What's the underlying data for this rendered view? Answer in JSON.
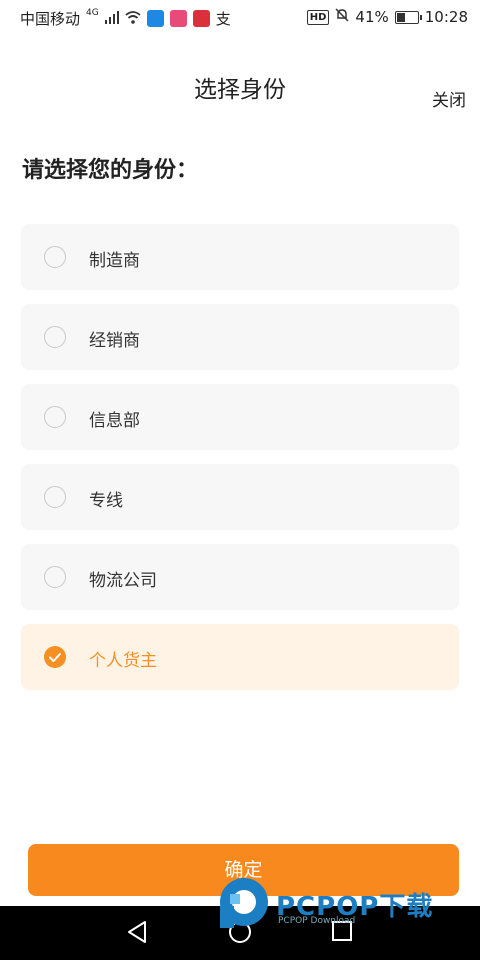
{
  "status_bar": {
    "carrier": "中国移动",
    "network": "4G",
    "battery": "41%",
    "battery_fraction": 0.41,
    "time": "10:28",
    "hd": "HD",
    "extra_glyph": "支"
  },
  "header": {
    "title": "选择身份",
    "close_label": "关闭"
  },
  "subtitle": "请选择您的身份：",
  "options": [
    {
      "label": "制造商",
      "selected": false
    },
    {
      "label": "经销商",
      "selected": false
    },
    {
      "label": "信息部",
      "selected": false
    },
    {
      "label": "专线",
      "selected": false
    },
    {
      "label": "物流公司",
      "selected": false
    },
    {
      "label": "个人货主",
      "selected": true
    }
  ],
  "confirm_label": "确定",
  "watermark": {
    "brand": "PCPOP下载",
    "sub": "PCPOP Download"
  },
  "colors": {
    "accent": "#f59024",
    "button": "#f7891f",
    "option_bg": "#f7f7f7",
    "selected_bg": "#fff3e6"
  }
}
